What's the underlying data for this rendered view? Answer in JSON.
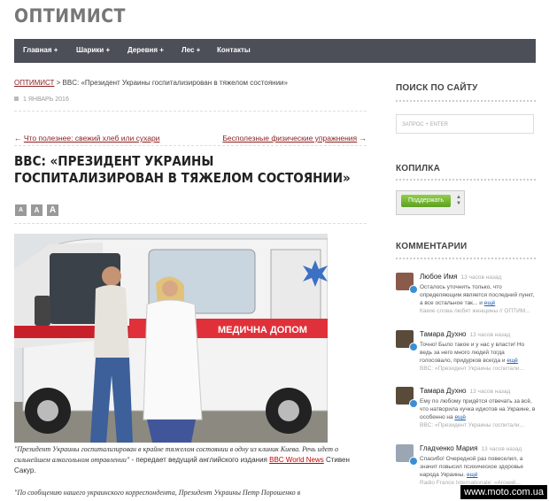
{
  "site": {
    "logo": "ОПТИМИСТ"
  },
  "nav": [
    {
      "label": "Главная +"
    },
    {
      "label": "Шарики +"
    },
    {
      "label": "Деревня +"
    },
    {
      "label": "Лес +"
    },
    {
      "label": "Контакты"
    }
  ],
  "breadcrumb": {
    "home": "ОПТИМИСТ",
    "sep": " > ",
    "current": "BBC: «Президент Украины госпитализирован в тяжелом состоянии»"
  },
  "post": {
    "date": "1 ЯНВАРЬ 2016",
    "prev_label": "Что полезнее: свежий хлеб или сухари",
    "next_label": "Бесполезные физические упражнения",
    "prev_arrow": "←",
    "next_arrow": "→",
    "title": "BBC: «ПРЕЗИДЕНТ УКРАИНЫ ГОСПИТАЛИЗИРОВАН В ТЯЖЕЛОМ СОСТОЯНИИ»",
    "font_sizes": [
      "A",
      "A",
      "A"
    ],
    "image_text": "МЕДИЧНА ДОПОМ",
    "lead_quote": "\"Президент Украины госпитализирован в крайне тяжелом состоянии в одну из клиник Киева. Речь идет о сильнейшем алкогольном отравлении\"",
    "lead_mid": " - передает ведущий английского издания ",
    "lead_link": "BBC World News",
    "lead_end": " Стивен Сакур.",
    "lead2": "\"По сообщению нашего украинского корреспондента, Президент Украины Петр Порошенко в"
  },
  "sidebar": {
    "search_title": "ПОИСК ПО САЙТУ",
    "search_placeholder": "ЗАПРОС + ENTER",
    "donate_title": "КОПИЛКА",
    "donate_button": "Поддержать",
    "comments_title": "КОММЕНТАРИИ",
    "comments": [
      {
        "name": "Любое Имя",
        "ago": "13 часов назад",
        "text": "Осталось уточнить только, что определяющим является последний пункт, а все остальное так... и",
        "more": "ещё",
        "source": "Какие слова любят женщины // ОПТИМ..."
      },
      {
        "name": "Тамара Духно",
        "ago": "13 часов назад",
        "text": "Точно! Было такое и у нас у власти! Но ведь за него много людей тогда голосовало, придурков всегда и",
        "more": "ещё",
        "source": "BBC: «Президент Украины госпитали..."
      },
      {
        "name": "Тамара Духно",
        "ago": "13 часов назад",
        "text": "Ему по любому придётся отвечать за всё, что натворила кучка идиотов на Украине, в особенно на",
        "more": "ещё",
        "source": "BBC: «Президент Украины госпитали..."
      },
      {
        "name": "Гладченко Мария",
        "ago": "13 часов назад",
        "text": "Спасибо! Очередной раз повеселил, а значит повысил психическое здоровье народа Украины.",
        "more": "ещё",
        "source": "Radio France Internationale: «Агоний..."
      }
    ]
  },
  "watermark": "www.moto.com.ua",
  "colors": {
    "nav_bg": "#4c4f58",
    "link": "#8b2020",
    "comment_link": "#1b5fb5"
  }
}
